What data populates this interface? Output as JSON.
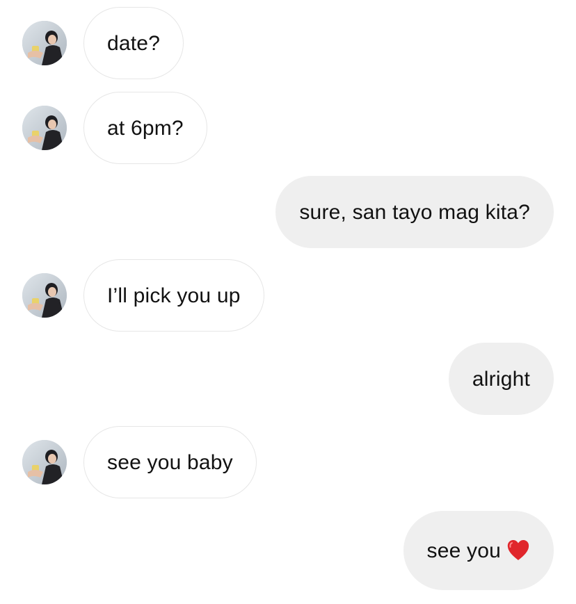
{
  "messages": [
    {
      "direction": "incoming",
      "text": "date?"
    },
    {
      "direction": "incoming",
      "text": "at 6pm?"
    },
    {
      "direction": "outgoing",
      "text": "sure, san tayo mag kita?"
    },
    {
      "direction": "incoming",
      "text": "I’ll pick you up"
    },
    {
      "direction": "outgoing",
      "text": "alright"
    },
    {
      "direction": "incoming",
      "text": "see you baby"
    },
    {
      "direction": "outgoing",
      "text": "see you",
      "emoji": "red-heart-icon"
    }
  ],
  "colors": {
    "incoming_bubble": "#ffffff",
    "incoming_border": "#e6e6e6",
    "outgoing_bubble": "#efefef",
    "text": "#111111",
    "heart": "#e0262b"
  }
}
